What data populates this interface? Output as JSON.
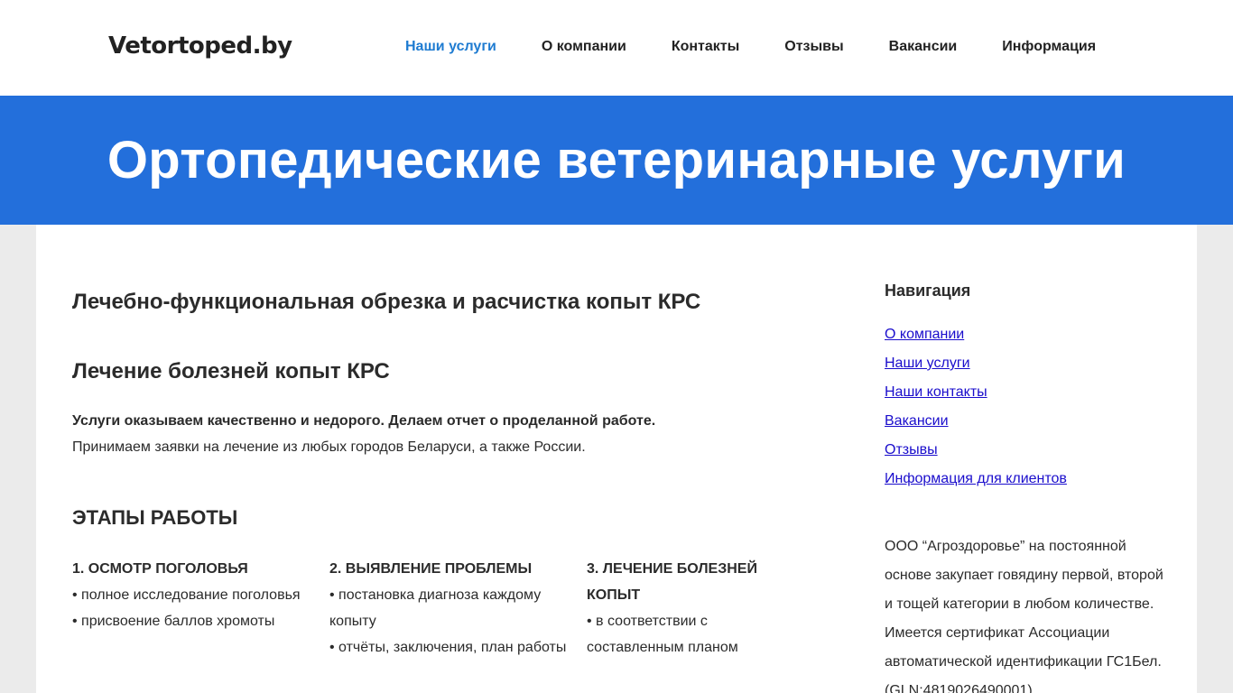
{
  "header": {
    "logo": "Vetortoped.by",
    "nav": [
      {
        "label": "Наши услуги",
        "active": true
      },
      {
        "label": "О компании",
        "active": false
      },
      {
        "label": "Контакты",
        "active": false
      },
      {
        "label": "Отзывы",
        "active": false
      },
      {
        "label": "Вакансии",
        "active": false
      },
      {
        "label": "Информация",
        "active": false
      }
    ]
  },
  "banner": {
    "title": "Ортопедические ветеринарные услуги"
  },
  "main": {
    "heading1": "Лечебно-функциональная обрезка и расчистка копыт КРС",
    "heading2": "Лечение болезней копыт КРС",
    "intro_bold": "Услуги оказываем качественно и недорого. Делаем отчет о проделанной работе.",
    "intro": "Принимаем заявки на лечение из любых городов Беларуси, а также России.",
    "stages_title": "ЭТАПЫ РАБОТЫ",
    "stages": [
      {
        "title": "1. Осмотр поголовья",
        "items": [
          "• полное исследование поголовья",
          "• присвоение баллов хромоты"
        ]
      },
      {
        "title": "2. Выявление проблемы",
        "items": [
          "• постановка диагноза каждому копыту",
          "• отчёты, заключения, план работы"
        ]
      },
      {
        "title": "3. Лечение болезней копыт",
        "items": [
          "• в соответствии с составленным планом"
        ]
      }
    ]
  },
  "sidebar": {
    "title": "Навигация",
    "links": [
      "О компании",
      "Наши услуги",
      "Наши контакты",
      "Вакансии",
      "Отзывы",
      "Информация для клиентов"
    ],
    "text": "ООО “Агроздоровье” на постоянной основе закупает говядину первой, второй и тощей категории в любом количестве. Имеется сертификат Ассоциации автоматической идентификации ГС1Бел. (GLN:4819026490001)"
  },
  "colors": {
    "accent": "#1e7bd1",
    "banner": "#236fdb",
    "link": "#1a0dcc",
    "page_bg": "#ebebeb"
  }
}
